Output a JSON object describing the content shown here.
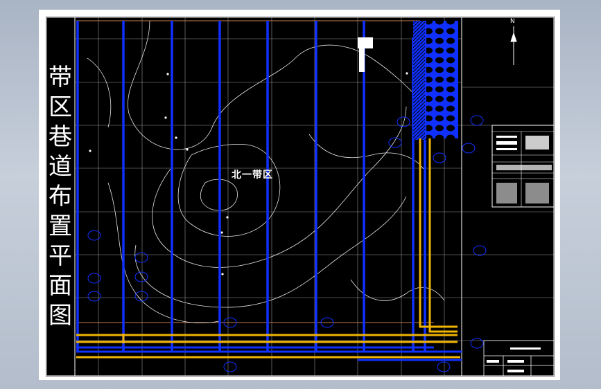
{
  "drawing": {
    "title_chars": [
      "带",
      "区",
      "巷",
      "道",
      "布",
      "置",
      "平",
      "面",
      "图"
    ],
    "zone_label": "北一带区",
    "north_label": "N",
    "colors": {
      "sheet": "#ffffff",
      "background": "#000000",
      "roadway": "#1030ff",
      "haulage": "#f0b400",
      "grid": "#c8c8c8",
      "contour": "#e8e8e8",
      "boundary": "#c87a4a"
    }
  }
}
